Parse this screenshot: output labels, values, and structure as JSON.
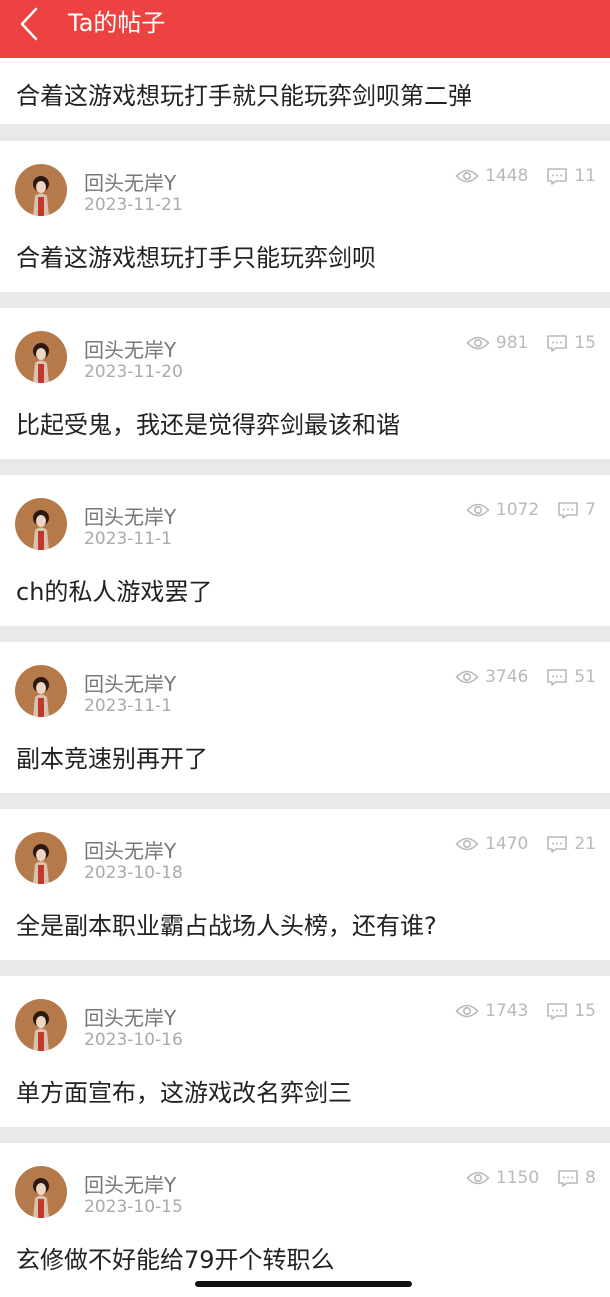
{
  "header": {
    "title": "Ta的帖子"
  },
  "top_post": {
    "title": "合着这游戏想玩打手就只能玩弈剑呗第二弹"
  },
  "posts": [
    {
      "username": "回头无岸Y",
      "date": "2023-11-21",
      "views": "1448",
      "comments": "11",
      "title": "合着这游戏想玩打手只能玩弈剑呗"
    },
    {
      "username": "回头无岸Y",
      "date": "2023-11-20",
      "views": "981",
      "comments": "15",
      "title": "比起受鬼，我还是觉得弈剑最该和谐"
    },
    {
      "username": "回头无岸Y",
      "date": "2023-11-1",
      "views": "1072",
      "comments": "7",
      "title": "ch的私人游戏罢了"
    },
    {
      "username": "回头无岸Y",
      "date": "2023-11-1",
      "views": "3746",
      "comments": "51",
      "title": "副本竞速别再开了"
    },
    {
      "username": "回头无岸Y",
      "date": "2023-10-18",
      "views": "1470",
      "comments": "21",
      "title": "全是副本职业霸占战场人头榜，还有谁?"
    },
    {
      "username": "回头无岸Y",
      "date": "2023-10-16",
      "views": "1743",
      "comments": "15",
      "title": "单方面宣布，这游戏改名弈剑三"
    },
    {
      "username": "回头无岸Y",
      "date": "2023-10-15",
      "views": "1150",
      "comments": "8",
      "title": "玄修做不好能给79开个转职么"
    }
  ],
  "icons": {
    "back": "chevron-left-icon",
    "views": "eye-icon",
    "comments": "comment-icon"
  },
  "colors": {
    "header": "#ee4242",
    "text": "#222222",
    "meta": "#aaaaaa"
  }
}
